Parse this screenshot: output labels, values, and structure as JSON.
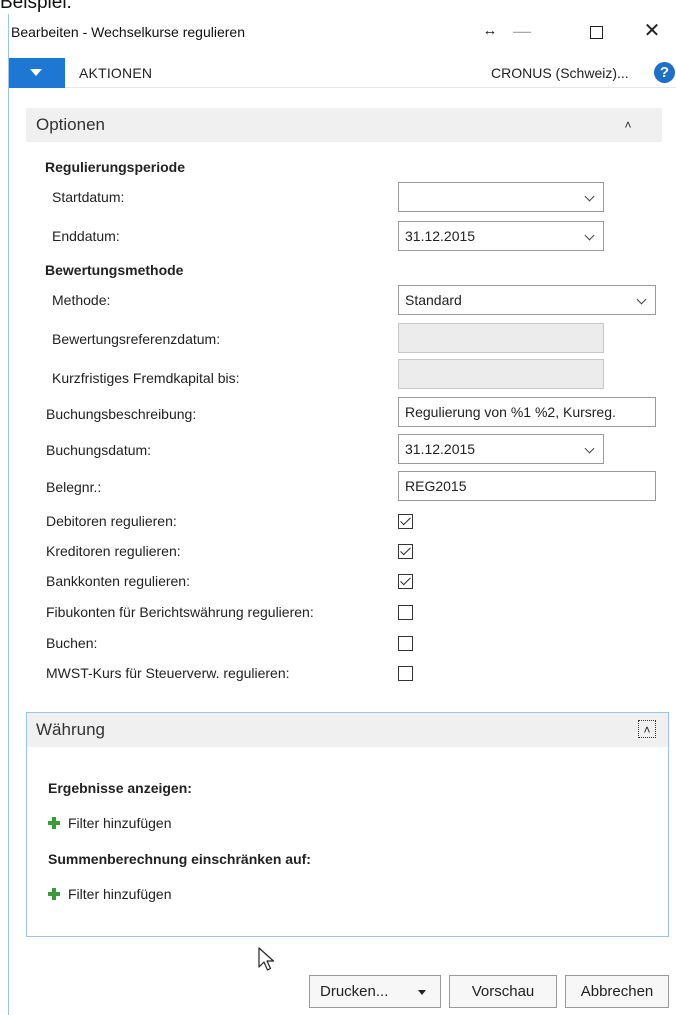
{
  "top_caption": "Beispiel:",
  "window": {
    "title": "Bearbeiten - Wechselkurse regulieren",
    "resize_symbol": "↔",
    "minimize_symbol": "—",
    "close_symbol": "✕"
  },
  "actionbar": {
    "actions_label": "AKTIONEN",
    "company": "CRONUS (Schweiz)...",
    "help_symbol": "?"
  },
  "options": {
    "header": "Optionen",
    "collapse_symbol": "˄",
    "regulation_period": {
      "group_label": "Regulierungsperiode",
      "start_label": "Startdatum:",
      "start_value": "",
      "end_label": "Enddatum:",
      "end_value": "31.12.2015"
    },
    "valuation": {
      "group_label": "Bewertungsmethode",
      "method_label": "Methode:",
      "method_value": "Standard",
      "ref_date_label": "Bewertungsreferenzdatum:",
      "ref_date_value": "",
      "short_term_label": "Kurzfristiges Fremdkapital bis:",
      "short_term_value": ""
    },
    "posting_description_label": "Buchungsbeschreibung:",
    "posting_description_value": "Regulierung von %1 %2, Kursreg.",
    "posting_date_label": "Buchungsdatum:",
    "posting_date_value": "31.12.2015",
    "doc_no_label": "Belegnr.:",
    "doc_no_value": "REG2015",
    "checkboxes": [
      {
        "label": "Debitoren regulieren:",
        "checked": true
      },
      {
        "label": "Kreditoren regulieren:",
        "checked": true
      },
      {
        "label": "Bankkonten regulieren:",
        "checked": true
      },
      {
        "label": "Fibukonten für Berichtswährung regulieren:",
        "checked": false
      },
      {
        "label": "Buchen:",
        "checked": false
      },
      {
        "label": "MWST-Kurs für Steuerverw. regulieren:",
        "checked": false
      }
    ]
  },
  "currency": {
    "header": "Währung",
    "collapse_symbol": "˄",
    "show_results_label": "Ergebnisse anzeigen:",
    "add_filter_1": "Filter hinzufügen",
    "restrict_totals_label": "Summenberechnung einschränken auf:",
    "add_filter_2": "Filter hinzufügen"
  },
  "buttons": {
    "print": "Drucken...",
    "preview": "Vorschau",
    "cancel": "Abbrechen"
  }
}
